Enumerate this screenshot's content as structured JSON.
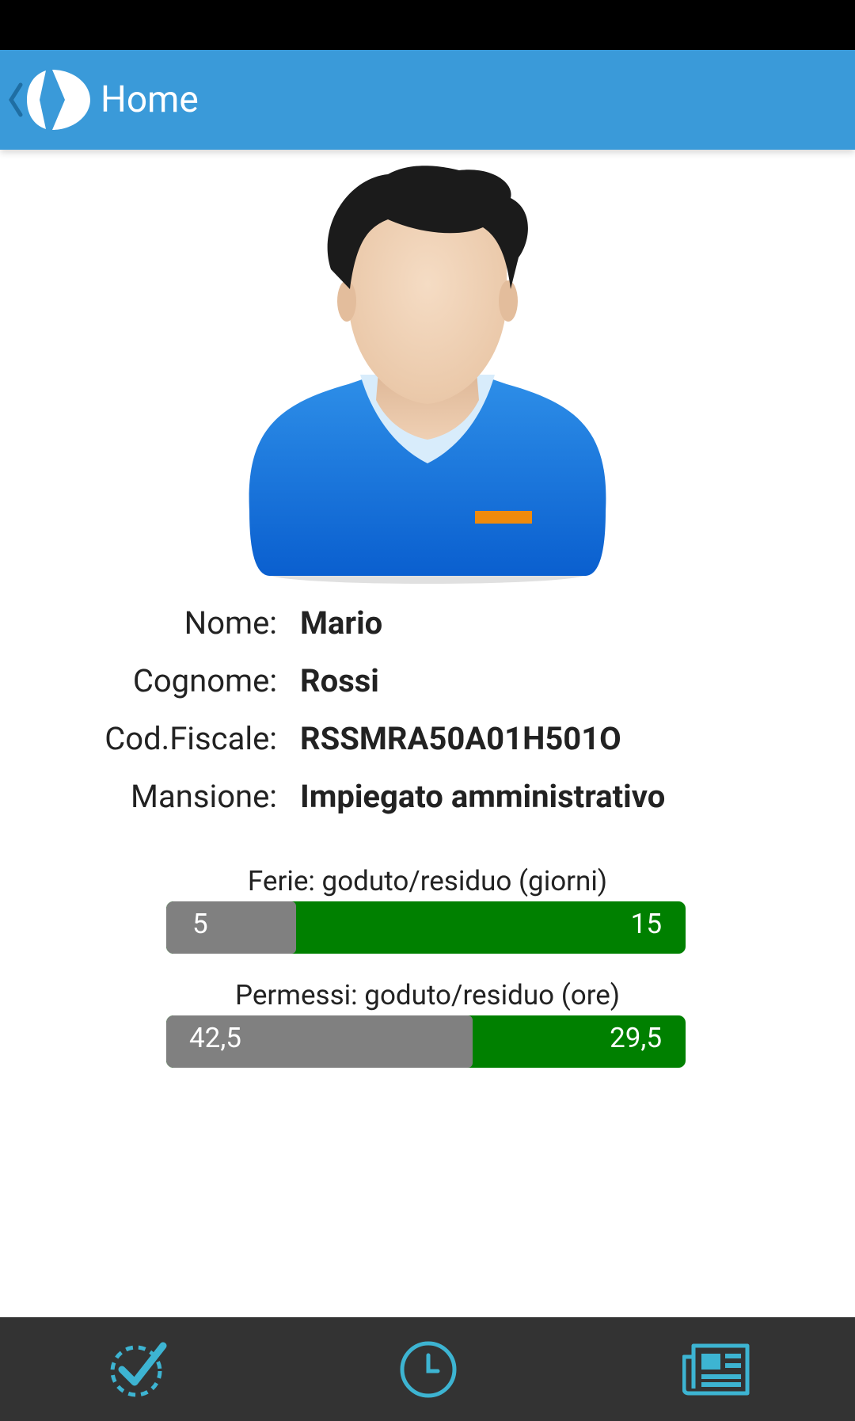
{
  "app_bar": {
    "title": "Home",
    "color": "#3a9ad9"
  },
  "profile": {
    "avatar_icon": "user-avatar-icon",
    "fields": [
      {
        "label": "Nome:",
        "value": "Mario"
      },
      {
        "label": "Cognome:",
        "value": "Rossi"
      },
      {
        "label": "Cod.Fiscale:",
        "value": "RSSMRA50A01H501O"
      },
      {
        "label": "Mansione:",
        "value": "Impiegato amministrativo"
      }
    ]
  },
  "balances": {
    "ferie": {
      "caption": "Ferie: goduto/residuo (giorni)",
      "used": 5,
      "used_label": "5",
      "remaining": 15,
      "remaining_label": "15"
    },
    "permessi": {
      "caption": "Permessi: goduto/residuo (ore)",
      "used": 42.5,
      "used_label": "42,5",
      "remaining": 29.5,
      "remaining_label": "29,5"
    },
    "used_color": "#808080",
    "remaining_color": "#008000"
  },
  "bottom_nav": {
    "items": [
      {
        "icon": "checkmark-icon"
      },
      {
        "icon": "clock-icon"
      },
      {
        "icon": "newspaper-icon"
      }
    ],
    "icon_color": "#3db4d2",
    "background": "#333333"
  }
}
